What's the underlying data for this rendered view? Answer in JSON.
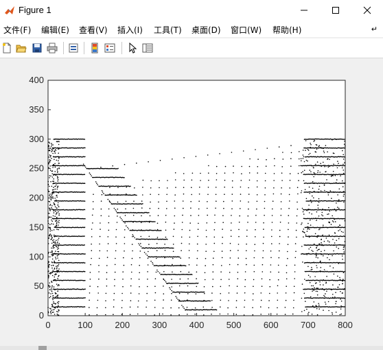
{
  "window": {
    "title": "Figure 1",
    "app_icon": "matlab-logo-icon",
    "controls": [
      "minimize-icon",
      "maximize-icon",
      "close-icon"
    ]
  },
  "menu": {
    "items": [
      "文件(F)",
      "编辑(E)",
      "查看(V)",
      "插入(I)",
      "工具(T)",
      "桌面(D)",
      "窗口(W)",
      "帮助(H)"
    ],
    "overflow_icon": "expand-arrow-icon"
  },
  "toolbar": {
    "buttons": [
      "new-figure-icon",
      "open-file-icon",
      "save-icon",
      "print-icon",
      "link-plot-icon",
      "insert-colorbar-icon",
      "insert-legend-icon",
      "edit-plot-arrow-icon",
      "property-inspector-icon"
    ]
  },
  "colors": {
    "window_bg": "#f0f0f0",
    "axes_bg": "#ffffff",
    "marker": "#000000"
  },
  "chart_data": {
    "type": "scatter",
    "title": "",
    "xlabel": "",
    "ylabel": "",
    "xlim": [
      0,
      800
    ],
    "ylim": [
      0,
      400
    ],
    "x_ticks": [
      0,
      100,
      200,
      300,
      400,
      500,
      600,
      700,
      800
    ],
    "y_ticks": [
      0,
      50,
      100,
      150,
      200,
      250,
      300,
      350,
      400
    ],
    "grid": false,
    "legend": "none",
    "marker": "dot",
    "regions": [
      {
        "name": "left-boundary-lines",
        "x_range": [
          10,
          100
        ],
        "y_values": [
          15,
          30,
          45,
          60,
          75,
          90,
          105,
          120,
          135,
          150,
          165,
          180,
          195,
          210,
          225,
          240,
          255,
          270,
          285,
          300
        ]
      },
      {
        "name": "diagonal-lines",
        "x_start_range": [
          105,
          370
        ],
        "length": 85,
        "y_values": [
          250,
          235,
          220,
          205,
          190,
          175,
          160,
          145,
          130,
          115,
          100,
          85,
          70,
          55,
          40,
          25,
          10
        ]
      },
      {
        "name": "sparse-interior-points",
        "x_range": [
          110,
          680
        ],
        "y_range": [
          0,
          290
        ]
      },
      {
        "name": "right-boundary-lines",
        "x_range": [
          680,
          800
        ],
        "y_values": [
          15,
          30,
          45,
          60,
          75,
          90,
          105,
          120,
          135,
          150,
          165,
          180,
          195,
          210,
          225,
          240,
          255,
          270,
          285,
          300
        ]
      }
    ]
  }
}
